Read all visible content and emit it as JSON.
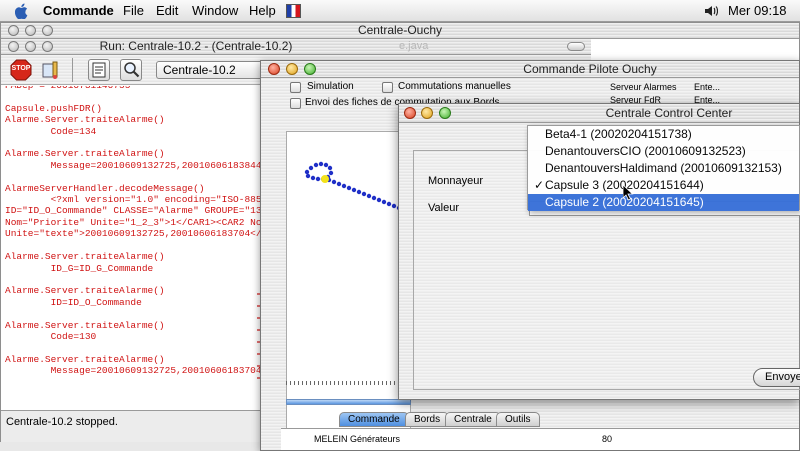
{
  "menubar": {
    "app_name": "Commande",
    "items": [
      "File",
      "Edit",
      "Window",
      "Help"
    ],
    "time": "Mer 09:18"
  },
  "ide_window": {
    "title": "Centrale-Ouchy",
    "run_title": "Run: Centrale-10.2 - (Centrale-10.2)",
    "faded_file": "e.java",
    "target_combo": "Centrale-10.2",
    "stop_label": "STOP",
    "status": "Centrale-10.2 stopped.",
    "console_lines": [
      "PADep = 20010731140755",
      "",
      "Capsule.pushFDR()",
      "Alarme.Server.traiteAlarme()",
      "        Code=134",
      "",
      "Alarme.Server.traiteAlarme()",
      "        Message=20010609132725,20010606183844",
      "",
      "AlarmeServerHandler.decodeMessage()",
      "        <?xml version=\"1.0\" encoding=\"ISO-8859-",
      "ID=\"ID_O_Commande\" CLASSE=\"Alarme\" GROUPE=\"13",
      "Nom=\"Priorite\" Unite=\"1_2_3\">1</CAR1><CAR2 No",
      "Unite=\"texte\">20010609132725,20010606183704</",
      "",
      "Alarme.Server.traiteAlarme()",
      "        ID_G=ID_G_Commande",
      "",
      "Alarme.Server.traiteAlarme()",
      "        ID=ID_O_Commande",
      "",
      "Alarme.Server.traiteAlarme()",
      "        Code=130",
      "",
      "Alarme.Server.traiteAlarme()",
      "        Message=20010609132725,20010606183704"
    ]
  },
  "pilot_window": {
    "title": "Commande Pilote Ouchy",
    "simulation_label": "Simulation",
    "commutations_label": "Commutations manuelles",
    "envoi_label": "Envoi des fiches de commutation aux Bords",
    "serveur_alarmes_label": "Serveur Alarmes",
    "serveur_alarmes_value": "Ente...",
    "serveur_fdr_label": "Serveur FdR",
    "serveur_fdr_value": "Ente...",
    "tabs": [
      "Commande",
      "Bords",
      "Centrale",
      "Outils"
    ],
    "active_tab": "Commande",
    "bottom_row": "MELEIN Générateurs",
    "bottom_value": "80"
  },
  "control_window": {
    "title": "Centrale Control Center",
    "monnayeur_label": "Monnayeur",
    "valeur_label": "Valeur",
    "valeur_value": "1",
    "envoyer_label": "Envoye",
    "dropdown_items": [
      "Beta4-1  (20020204151738)",
      "DenantouversCIO  (20010609132523)",
      "DenantouversHaldimand  (20010609132153)",
      "Capsule 3  (20020204151644)",
      "Capsule 2  (20020204151645)"
    ],
    "checked_item": "Capsule 3  (20020204151644)",
    "highlighted_item": "Capsule 2  (20020204151645)",
    "checkmark": "✓"
  }
}
